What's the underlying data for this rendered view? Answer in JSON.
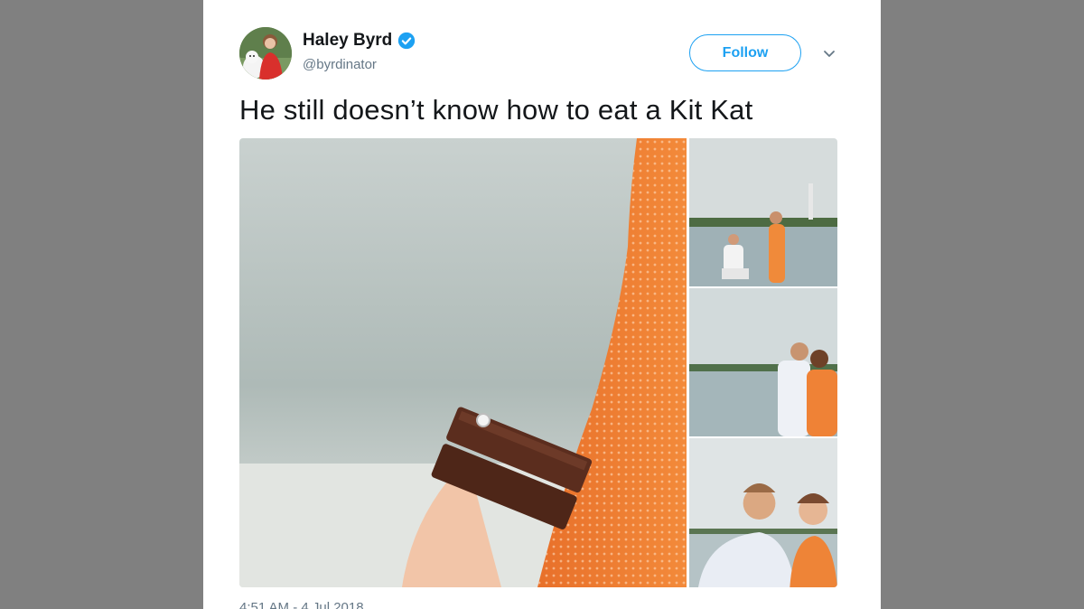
{
  "tweet": {
    "display_name": "Haley Byrd",
    "handle": "@byrdinator",
    "verified": true,
    "follow_label": "Follow",
    "text": "He still doesn’t know how to eat a Kit Kat",
    "timestamp": "4:51 AM - 4 Jul 2018",
    "media": {
      "main_alt_brand": "KitKat",
      "photo_count": 4
    }
  },
  "icons": {
    "verified": "verified-badge-icon",
    "caret": "chevron-down-icon"
  },
  "colors": {
    "accent": "#1da1f2",
    "text": "#14171a",
    "muted": "#657786",
    "backdrop": "#808080"
  }
}
